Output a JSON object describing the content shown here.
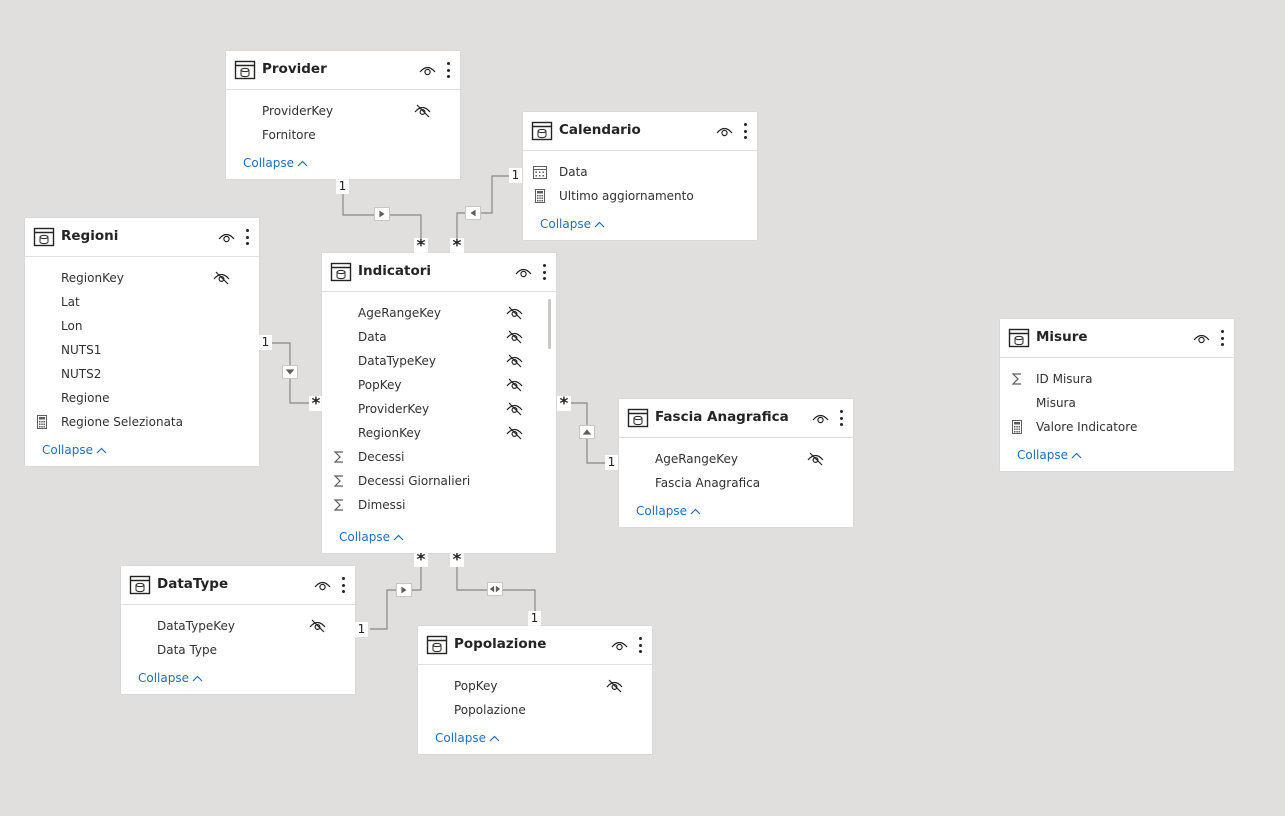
{
  "tables": {
    "provider": {
      "title": "Provider",
      "fields": [
        {
          "name": "ProviderKey",
          "hidden": true
        },
        {
          "name": "Fornitore"
        }
      ],
      "collapse": "Collapse"
    },
    "calendario": {
      "title": "Calendario",
      "fields": [
        {
          "name": "Data",
          "icon": "calendar-icon"
        },
        {
          "name": "Ultimo aggiornamento",
          "icon": "calculator-icon"
        }
      ],
      "collapse": "Collapse"
    },
    "regioni": {
      "title": "Regioni",
      "fields": [
        {
          "name": "RegionKey",
          "hidden": true
        },
        {
          "name": "Lat"
        },
        {
          "name": "Lon"
        },
        {
          "name": "NUTS1"
        },
        {
          "name": "NUTS2"
        },
        {
          "name": "Regione"
        },
        {
          "name": "Regione Selezionata",
          "icon": "calculator-icon"
        }
      ],
      "collapse": "Collapse"
    },
    "indicatori": {
      "title": "Indicatori",
      "fields": [
        {
          "name": "AgeRangeKey",
          "hidden": true
        },
        {
          "name": "Data",
          "hidden": true
        },
        {
          "name": "DataTypeKey",
          "hidden": true
        },
        {
          "name": "PopKey",
          "hidden": true
        },
        {
          "name": "ProviderKey",
          "hidden": true
        },
        {
          "name": "RegionKey",
          "hidden": true
        },
        {
          "name": "Decessi",
          "icon": "sigma-icon"
        },
        {
          "name": "Decessi Giornalieri",
          "icon": "sigma-icon"
        },
        {
          "name": "Dimessi",
          "icon": "sigma-icon"
        }
      ],
      "collapse": "Collapse"
    },
    "fascia": {
      "title": "Fascia Anagrafica",
      "fields": [
        {
          "name": "AgeRangeKey",
          "hidden": true
        },
        {
          "name": "Fascia Anagrafica"
        }
      ],
      "collapse": "Collapse"
    },
    "misure": {
      "title": "Misure",
      "fields": [
        {
          "name": "ID Misura",
          "icon": "sigma-icon"
        },
        {
          "name": "Misura"
        },
        {
          "name": "Valore Indicatore",
          "icon": "calculator-icon"
        }
      ],
      "collapse": "Collapse"
    },
    "datatype": {
      "title": "DataType",
      "fields": [
        {
          "name": "DataTypeKey",
          "hidden": true
        },
        {
          "name": "Data Type"
        }
      ],
      "collapse": "Collapse"
    },
    "popolazione": {
      "title": "Popolazione",
      "fields": [
        {
          "name": "PopKey",
          "hidden": true
        },
        {
          "name": "Popolazione"
        }
      ],
      "collapse": "Collapse"
    }
  },
  "relationships": {
    "one": "1",
    "many": "*"
  },
  "colors": {
    "canvas": "#e1dfdd",
    "card": "#ffffff",
    "line": "#8a8886",
    "link": "#1f6fbf"
  }
}
